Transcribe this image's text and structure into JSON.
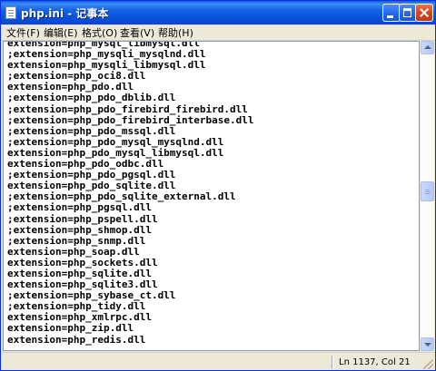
{
  "window": {
    "title": "php.ini - 记事本",
    "icon": "notepad-icon"
  },
  "menu": {
    "items": [
      "文件(F)",
      "编辑(E)",
      "格式(O)",
      "查看(V)",
      "帮助(H)"
    ]
  },
  "editor": {
    "lines": [
      "extension=php_mysql_libmysql.dll",
      ";extension=php_mysqli_mysqlnd.dll",
      "extension=php_mysqli_libmysql.dll",
      ";extension=php_oci8.dll",
      "extension=php_pdo.dll",
      ";extension=php_pdo_dblib.dll",
      ";extension=php_pdo_firebird_firebird.dll",
      ";extension=php_pdo_firebird_interbase.dll",
      ";extension=php_pdo_mssql.dll",
      ";extension=php_pdo_mysql_mysqlnd.dll",
      "extension=php_pdo_mysql_libmysql.dll",
      "extension=php_pdo_odbc.dll",
      ";extension=php_pdo_pgsql.dll",
      "extension=php_pdo_sqlite.dll",
      ";extension=php_pdo_sqlite_external.dll",
      ";extension=php_pgsql.dll",
      ";extension=php_pspell.dll",
      ";extension=php_shmop.dll",
      ";extension=php_snmp.dll",
      "extension=php_soap.dll",
      "extension=php_sockets.dll",
      "extension=php_sqlite.dll",
      "extension=php_sqlite3.dll",
      ";extension=php_sybase_ct.dll",
      ";extension=php_tidy.dll",
      "extension=php_xmlrpc.dll",
      "extension=php_zip.dll",
      "extension=php_redis.dll"
    ]
  },
  "status": {
    "position": "Ln 1137, Col 21"
  },
  "colors": {
    "titlebar": "#0a5ee8",
    "close_button": "#d6431a",
    "chrome": "#ece9d8"
  }
}
